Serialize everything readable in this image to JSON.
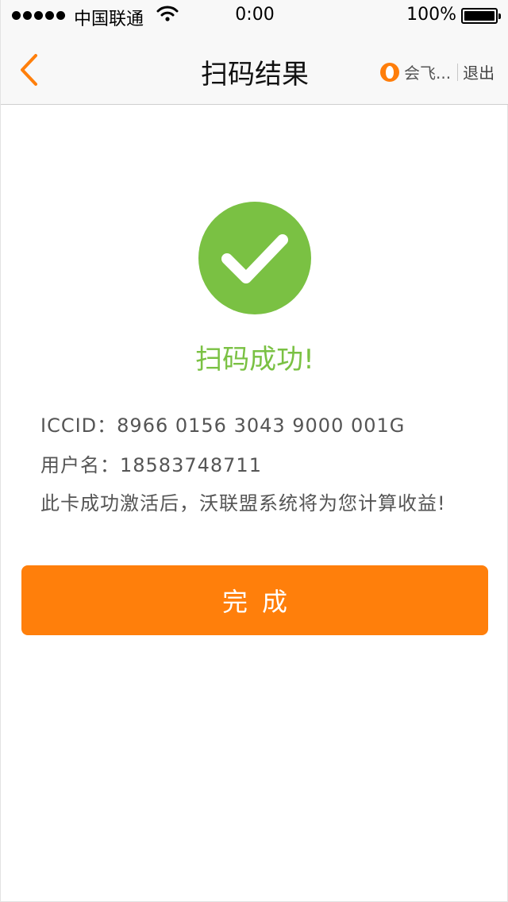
{
  "status_bar": {
    "carrier": "中国联通",
    "time": "0:00",
    "battery": "100%"
  },
  "nav": {
    "title": "扫码结果",
    "user_name": "会飞...",
    "logout": "退出"
  },
  "result": {
    "title": "扫码成功!",
    "iccid_line": "ICCID：8966 0156 3043 9000 001G",
    "user_line": "用户名：18583748711",
    "note": "此卡成功激活后，沃联盟系统将为您计算收益!"
  },
  "actions": {
    "done_label": "完成"
  },
  "colors": {
    "accent": "#ff7f0b",
    "success": "#7ac143"
  },
  "icons": [
    "signal-icon",
    "wifi-icon",
    "battery-icon",
    "back-chevron-icon",
    "user-avatar-icon",
    "checkmark-icon"
  ]
}
